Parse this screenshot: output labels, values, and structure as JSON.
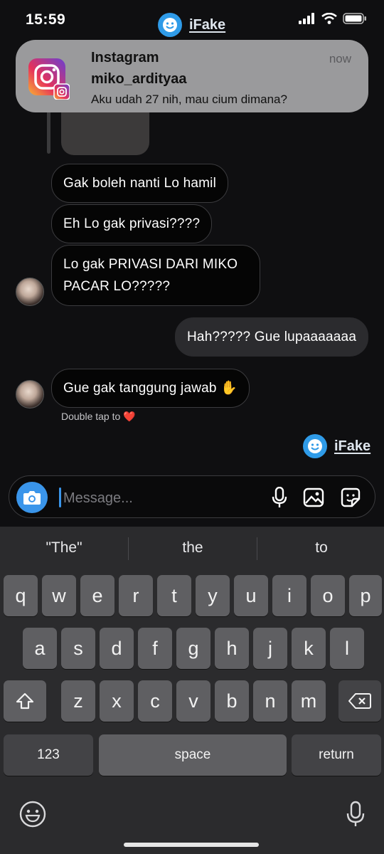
{
  "status_bar": {
    "time": "15:59",
    "brand": "iFake"
  },
  "notification": {
    "app": "Instagram",
    "time": "now",
    "username": "miko_ardityaa",
    "message": "Aku udah 27 nih, mau cium dimana?"
  },
  "chat": {
    "messages": [
      {
        "text": "Gak boleh nanti Lo hamil",
        "direction": "incoming"
      },
      {
        "text": "Eh Lo gak privasi????",
        "direction": "incoming"
      },
      {
        "text": "Lo gak PRIVASI DARI MIKO PACAR LO?????",
        "direction": "incoming"
      },
      {
        "text": "Hah????? Gue lupaaaaaaa",
        "direction": "outgoing"
      },
      {
        "text": "Gue gak tanggung jawab ✋",
        "direction": "incoming"
      }
    ],
    "double_tap_hint": "Double tap to ❤️",
    "watermark": "iFake"
  },
  "composer": {
    "placeholder": "Message..."
  },
  "keyboard": {
    "suggestions": [
      "\"The\"",
      "the",
      "to"
    ],
    "row1": [
      "q",
      "w",
      "e",
      "r",
      "t",
      "y",
      "u",
      "i",
      "o",
      "p"
    ],
    "row2": [
      "a",
      "s",
      "d",
      "f",
      "g",
      "h",
      "j",
      "k",
      "l"
    ],
    "row3": [
      "z",
      "x",
      "c",
      "v",
      "b",
      "n",
      "m"
    ],
    "numbers_key": "123",
    "space_key": "space",
    "return_key": "return"
  },
  "colors": {
    "accent": "#3a95ea",
    "bubble_in": "#050505",
    "bubble_out": "#2b2b2e",
    "notification_bg": "#9a9a9c"
  }
}
